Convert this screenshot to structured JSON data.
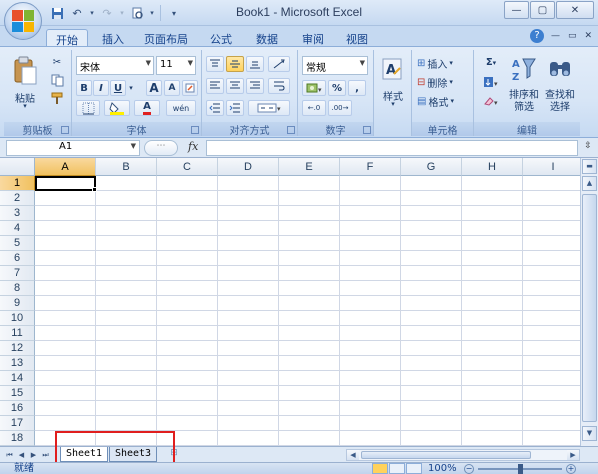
{
  "window": {
    "title": "Book1 - Microsoft Excel",
    "minimize_icon": "minimize-icon",
    "restore_icon": "restore-icon",
    "close_icon": "close-icon"
  },
  "quick_access": {
    "icons": [
      "save-icon",
      "undo-icon",
      "redo-icon",
      "print-preview-icon",
      "customize-icon"
    ]
  },
  "tabs": [
    {
      "label": "开始",
      "active": true
    },
    {
      "label": "插入",
      "active": false
    },
    {
      "label": "页面布局",
      "active": false
    },
    {
      "label": "公式",
      "active": false
    },
    {
      "label": "数据",
      "active": false
    },
    {
      "label": "审阅",
      "active": false
    },
    {
      "label": "视图",
      "active": false
    }
  ],
  "ribbon": {
    "clipboard": {
      "paste_label": "粘贴",
      "group_label": "剪贴板"
    },
    "font": {
      "font_name": "宋体",
      "font_size": "11",
      "bold": "B",
      "italic": "I",
      "underline": "U",
      "grow": "A",
      "shrink": "A",
      "font_color_letter": "A",
      "phonetic": "wén",
      "group_label": "字体"
    },
    "alignment": {
      "group_label": "对齐方式"
    },
    "number": {
      "format": "常规",
      "percent": "%",
      "comma": ",",
      "group_label": "数字"
    },
    "styles": {
      "label": "样式"
    },
    "cells": {
      "insert": "插入",
      "delete": "删除",
      "format": "格式",
      "group_label": "单元格"
    },
    "editing": {
      "sort_filter_1": "排序和",
      "sort_filter_2": "筛选",
      "find_select_1": "查找和",
      "find_select_2": "选择",
      "sigma": "Σ",
      "group_label": "编辑"
    }
  },
  "formula_bar": {
    "name_box": "A1",
    "fx": "fx",
    "value": ""
  },
  "grid": {
    "columns": [
      "A",
      "B",
      "C",
      "D",
      "E",
      "F",
      "G",
      "H",
      "I"
    ],
    "rows": [
      "1",
      "2",
      "3",
      "4",
      "5",
      "6",
      "7",
      "8",
      "9",
      "10",
      "11",
      "12",
      "13",
      "14",
      "15",
      "16",
      "17",
      "18"
    ],
    "selected_column": "A",
    "selected_row": "1"
  },
  "sheets": [
    {
      "name": "Sheet1",
      "active": true
    },
    {
      "name": "Sheet3",
      "active": false
    }
  ],
  "status": {
    "ready": "就绪",
    "zoom": "100%",
    "minus": "−",
    "plus": "+"
  },
  "colors": {
    "highlight_box": "#e01e1e",
    "selected_header": "#f1c15f"
  }
}
